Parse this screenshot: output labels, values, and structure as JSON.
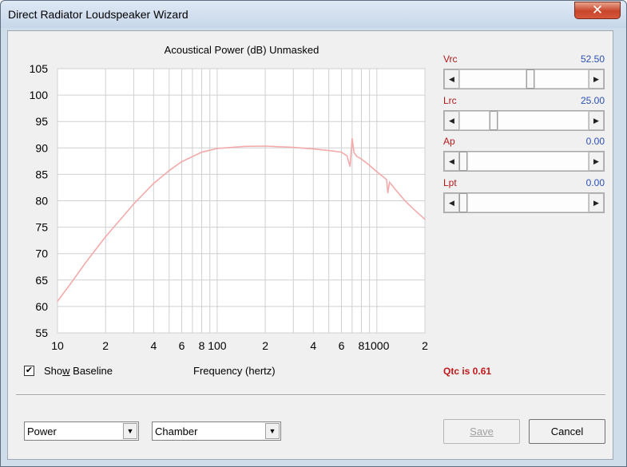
{
  "window": {
    "title": "Direct Radiator Loudspeaker Wizard",
    "close_glyph": "✕"
  },
  "chart": {
    "title": "Acoustical Power (dB)   Unmasked",
    "xlabel": "Frequency (hertz)"
  },
  "chart_data": {
    "type": "line",
    "title": "Acoustical Power (dB)   Unmasked",
    "xlabel": "Frequency (hertz)",
    "ylabel": "",
    "xscale": "log",
    "xlim": [
      10,
      2000
    ],
    "ylim": [
      55,
      105
    ],
    "yticks": [
      55,
      60,
      65,
      70,
      75,
      80,
      85,
      90,
      95,
      100,
      105
    ],
    "xticks": [
      {
        "v": 10,
        "label": "10"
      },
      {
        "v": 20,
        "label": "2"
      },
      {
        "v": 40,
        "label": "4"
      },
      {
        "v": 60,
        "label": "6"
      },
      {
        "v": 80,
        "label": "8"
      },
      {
        "v": 100,
        "label": "100"
      },
      {
        "v": 200,
        "label": "2"
      },
      {
        "v": 400,
        "label": "4"
      },
      {
        "v": 600,
        "label": "6"
      },
      {
        "v": 800,
        "label": "8"
      },
      {
        "v": 1000,
        "label": "1000"
      },
      {
        "v": 2000,
        "label": "2"
      }
    ],
    "grid": true,
    "series_color": "#f4aaaa",
    "series": [
      {
        "x": [
          10,
          12,
          15,
          20,
          25,
          30,
          40,
          50,
          60,
          80,
          100,
          150,
          200,
          300,
          400,
          500,
          600,
          650,
          680,
          700,
          720,
          750,
          800,
          900,
          1000,
          1100,
          1150,
          1170,
          1200,
          1300,
          1500,
          1700,
          2000
        ],
        "y": [
          61.0,
          64.2,
          68.3,
          73.2,
          76.6,
          79.4,
          83.3,
          85.7,
          87.4,
          89.2,
          89.9,
          90.3,
          90.35,
          90.1,
          89.8,
          89.5,
          89.2,
          88.5,
          86.5,
          91.8,
          89.1,
          88.4,
          87.9,
          86.7,
          85.5,
          84.5,
          84.0,
          81.5,
          83.5,
          82.2,
          80.0,
          78.4,
          76.5
        ]
      }
    ]
  },
  "params": [
    {
      "label": "Vrc",
      "value": "52.50",
      "level": 0.55
    },
    {
      "label": "Lrc",
      "value": "25.00",
      "level": 0.25
    },
    {
      "label": "Ap",
      "value": "0.00",
      "level": 0.0
    },
    {
      "label": "Lpt",
      "value": "0.00",
      "level": 0.0
    }
  ],
  "show_baseline": {
    "pre": "Sho",
    "accel": "w",
    "post": " Baseline",
    "checked": true,
    "check_glyph": "✔"
  },
  "qtc": "Qtc is 0.61",
  "combos": {
    "mode": "Power",
    "environment": "Chamber",
    "arrow_glyph": "▼"
  },
  "buttons": {
    "save": "Save",
    "cancel": "Cancel"
  },
  "scroll_glyphs": {
    "left": "◀",
    "right": "▶"
  }
}
